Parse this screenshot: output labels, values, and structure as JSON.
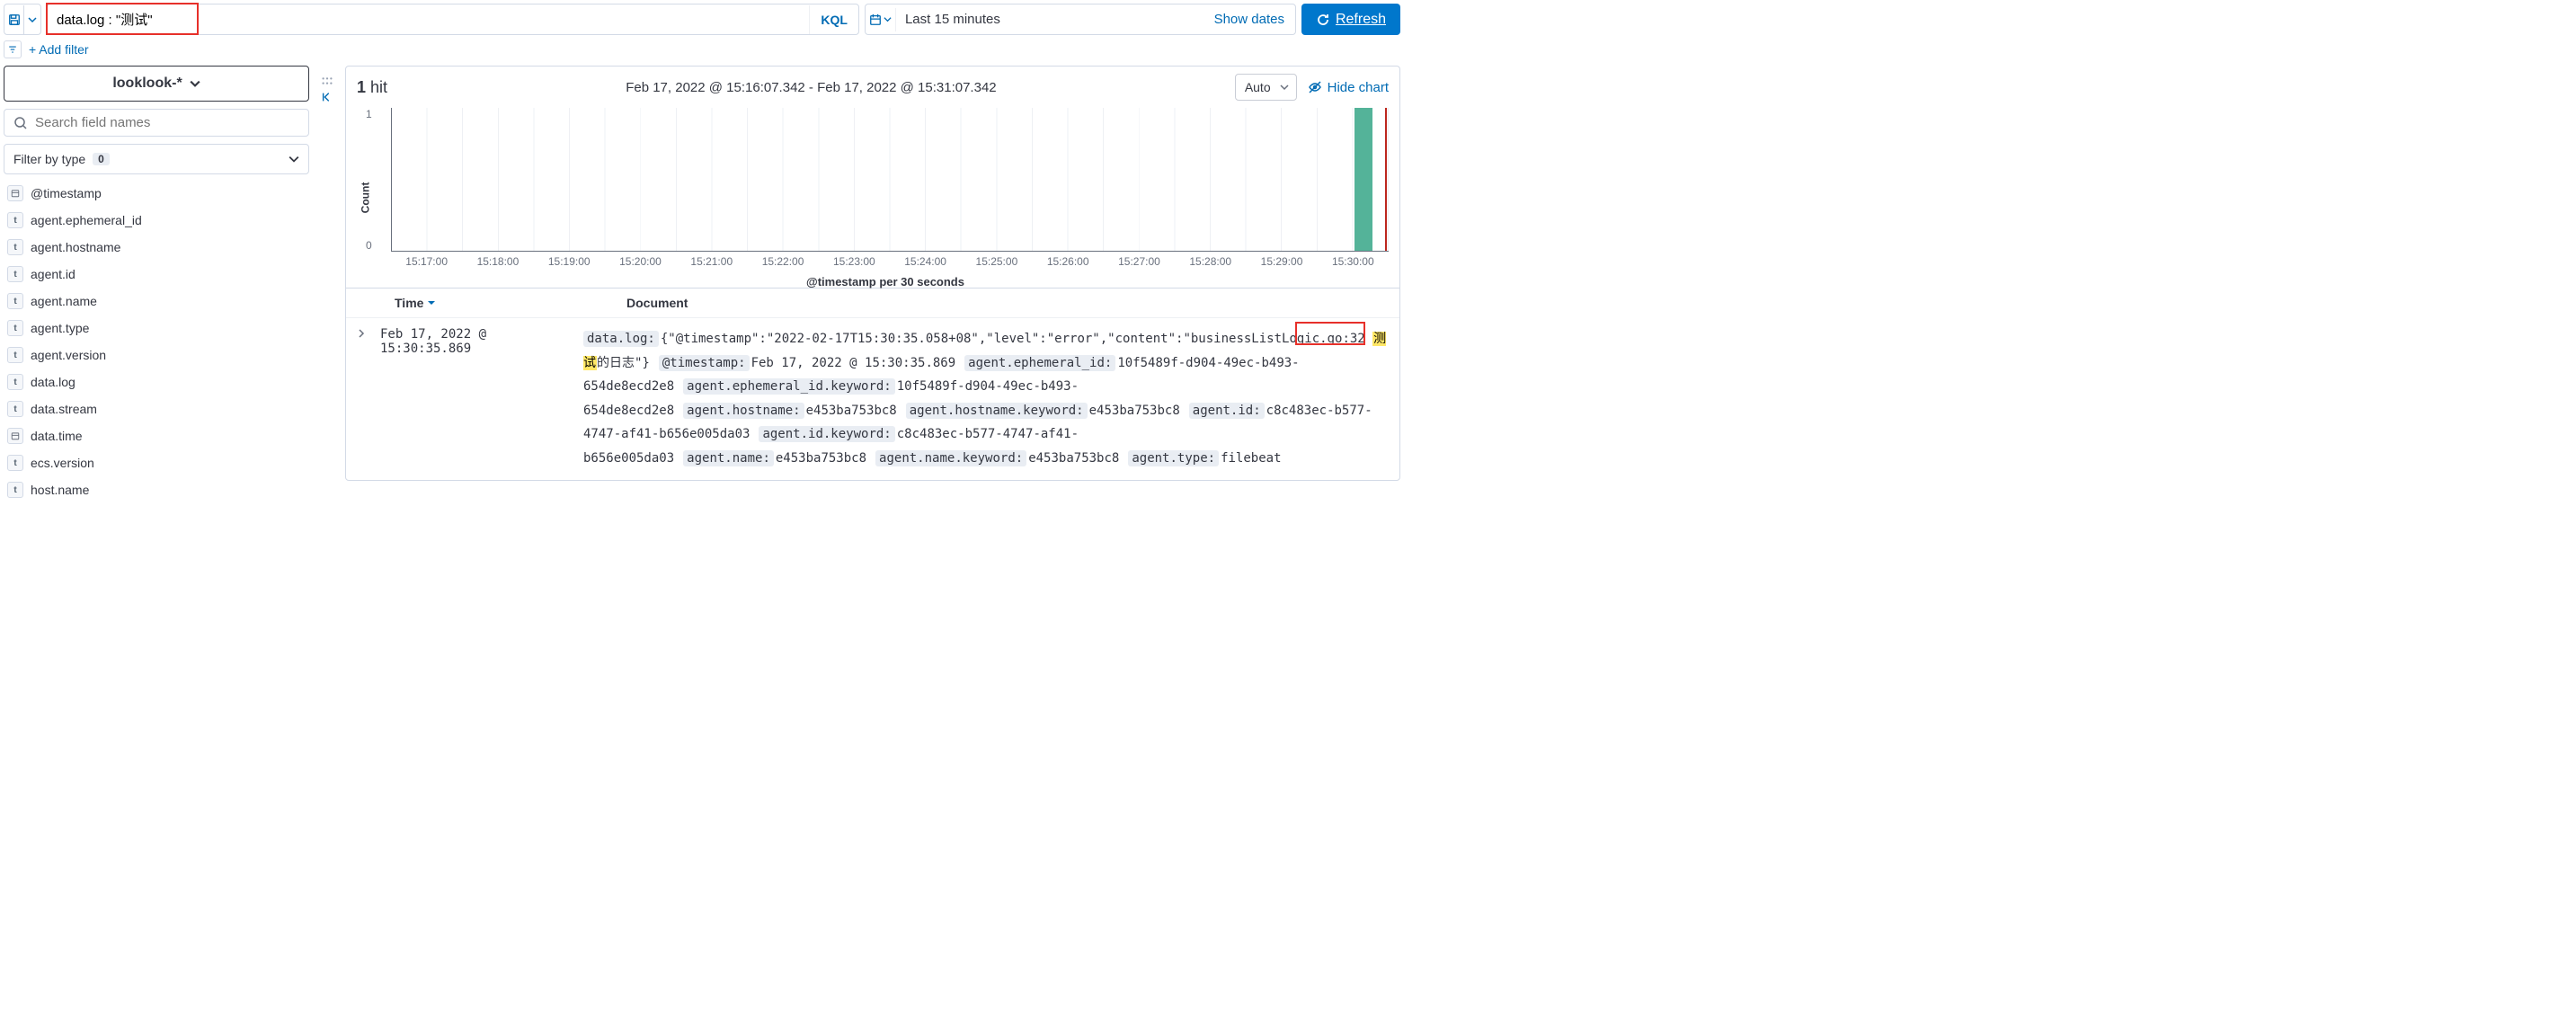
{
  "query": {
    "value": "data.log : \"测试\"",
    "language_label": "KQL"
  },
  "date": {
    "range": "Last 15 minutes",
    "show_dates": "Show dates"
  },
  "refresh_label": "Refresh",
  "add_filter": "+ Add filter",
  "index_pattern": "looklook-*",
  "field_search_placeholder": "Search field names",
  "filter_by_type": {
    "label": "Filter by type",
    "count": "0"
  },
  "fields": [
    {
      "type": "date",
      "name": "@timestamp"
    },
    {
      "type": "t",
      "name": "agent.ephemeral_id"
    },
    {
      "type": "t",
      "name": "agent.hostname"
    },
    {
      "type": "t",
      "name": "agent.id"
    },
    {
      "type": "t",
      "name": "agent.name"
    },
    {
      "type": "t",
      "name": "agent.type"
    },
    {
      "type": "t",
      "name": "agent.version"
    },
    {
      "type": "t",
      "name": "data.log"
    },
    {
      "type": "t",
      "name": "data.stream"
    },
    {
      "type": "date",
      "name": "data.time"
    },
    {
      "type": "t",
      "name": "ecs.version"
    },
    {
      "type": "t",
      "name": "host.name"
    }
  ],
  "hits": {
    "count": "1",
    "label": "hit"
  },
  "timerange_display": "Feb 17, 2022 @ 15:16:07.342 - Feb 17, 2022 @ 15:31:07.342",
  "interval_select": "Auto",
  "hide_chart": "Hide chart",
  "chart_data": {
    "type": "bar",
    "ylabel": "Count",
    "xlabel": "@timestamp per 30 seconds",
    "ylim": [
      0,
      1
    ],
    "yticks": [
      "1",
      "0"
    ],
    "xticks": [
      "15:17:00",
      "15:18:00",
      "15:19:00",
      "15:20:00",
      "15:21:00",
      "15:22:00",
      "15:23:00",
      "15:24:00",
      "15:25:00",
      "15:26:00",
      "15:27:00",
      "15:28:00",
      "15:29:00",
      "15:30:00"
    ],
    "series": [
      {
        "name": "count",
        "bucket": "15:30:30",
        "value": 1
      }
    ]
  },
  "table": {
    "columns": {
      "time": "Time",
      "document": "Document"
    },
    "row": {
      "time": "Feb 17, 2022 @ 15:30:35.869",
      "highlight": "测试",
      "kv": [
        {
          "key": "data.log:",
          "val_pre": "{\"@timestamp\":\"2022-02-17T15:30:35.058+08\",\"level\":\"error\",\"content\":\"businessListLogic.go:32 ",
          "val_mark": "测试",
          "val_post": "的日志\"}"
        },
        {
          "key": "@timestamp:",
          "val": "Feb 17, 2022 @ 15:30:35.869"
        },
        {
          "key": "agent.ephemeral_id:",
          "val": "10f5489f-d904-49ec-b493-654de8ecd2e8"
        },
        {
          "key": "agent.ephemeral_id.keyword:",
          "val": "10f5489f-d904-49ec-b493-654de8ecd2e8"
        },
        {
          "key": "agent.hostname:",
          "val": "e453ba753bc8"
        },
        {
          "key": "agent.hostname.keyword:",
          "val": "e453ba753bc8"
        },
        {
          "key": "agent.id:",
          "val": "c8c483ec-b577-4747-af41-b656e005da03"
        },
        {
          "key": "agent.id.keyword:",
          "val": "c8c483ec-b577-4747-af41-b656e005da03"
        },
        {
          "key": "agent.name:",
          "val": "e453ba753bc8"
        },
        {
          "key": "agent.name.keyword:",
          "val": "e453ba753bc8"
        },
        {
          "key": "agent.type:",
          "val": "filebeat"
        }
      ]
    }
  }
}
